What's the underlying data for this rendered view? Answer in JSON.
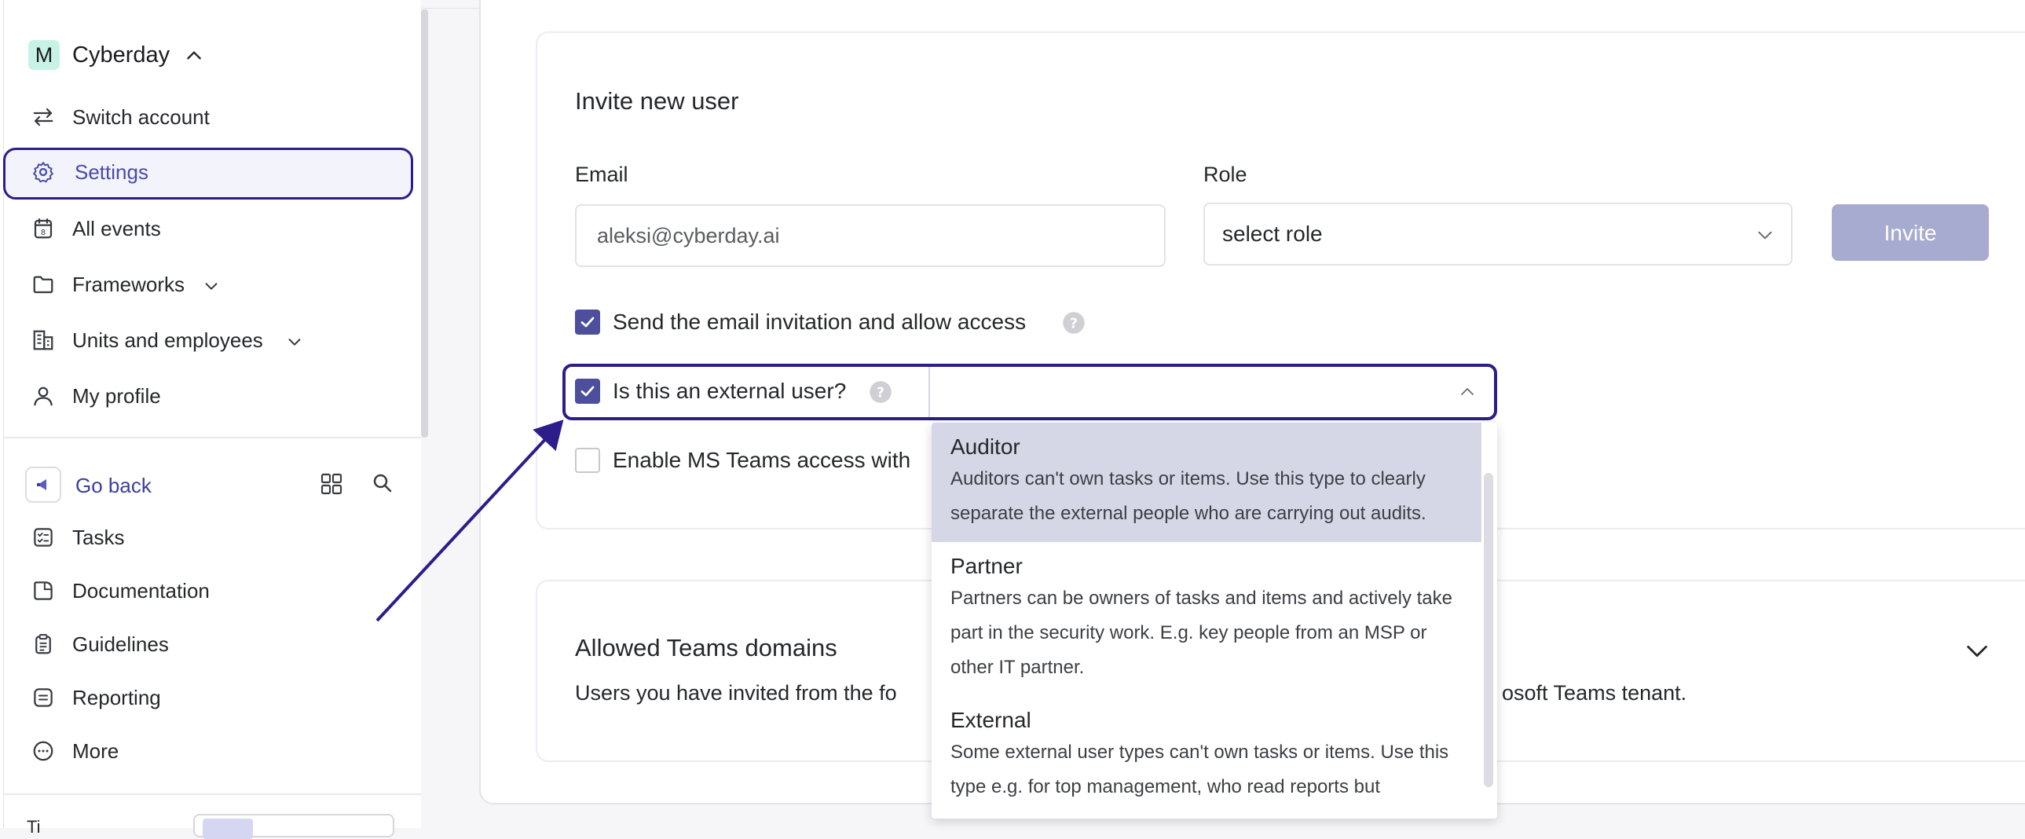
{
  "sidebar": {
    "account": {
      "badge": "M",
      "name": "Cyberday"
    },
    "nav": [
      {
        "label": "Switch account",
        "icon": "switch-arrows-icon"
      },
      {
        "label": "Settings",
        "icon": "gear-icon",
        "active": true
      },
      {
        "label": "All events",
        "icon": "calendar-icon"
      },
      {
        "label": "Frameworks",
        "icon": "folder-icon",
        "expandable": true
      },
      {
        "label": "Units and employees",
        "icon": "building-icon",
        "expandable": true
      },
      {
        "label": "My profile",
        "icon": "user-icon"
      }
    ],
    "go_back": "Go back",
    "sub_nav": [
      {
        "label": "Tasks",
        "icon": "checklist-icon"
      },
      {
        "label": "Documentation",
        "icon": "document-icon"
      },
      {
        "label": "Guidelines",
        "icon": "clipboard-icon"
      },
      {
        "label": "Reporting",
        "icon": "report-icon"
      },
      {
        "label": "More",
        "icon": "more-icon"
      }
    ],
    "bottom_cut_text": "Ti"
  },
  "invite": {
    "title": "Invite new user",
    "email_label": "Email",
    "email_value": "aleksi@cyberday.ai",
    "role_label": "Role",
    "role_placeholder": "select role",
    "invite_button": "Invite",
    "send_email_label": "Send the email invitation and allow access",
    "send_email_checked": true,
    "external_label": "Is this an external user?",
    "external_checked": true,
    "ms_teams_label": "Enable MS Teams access with",
    "ms_teams_checked": false
  },
  "external_type_dropdown": {
    "options": [
      {
        "title": "Auditor",
        "description": "Auditors can't own tasks or items. Use this type to clearly separate the external people who are carrying out audits.",
        "highlighted": true
      },
      {
        "title": "Partner",
        "description": "Partners can be owners of tasks and items and actively take part in the security work. E.g. key people from an MSP or other IT partner."
      },
      {
        "title": "External",
        "description": "Some external user types can't own tasks or items. Use this type e.g. for top management, who read reports but"
      }
    ]
  },
  "teams_domains": {
    "title": "Allowed Teams domains",
    "desc_left": "Users you have invited from the fo",
    "desc_right": "osoft Teams tenant."
  },
  "colors": {
    "accent": "#4d4f9c",
    "highlight_outline": "#2d1d8a",
    "invite_button_disabled": "#a7abcf",
    "selected_option": "#d6d7e6",
    "account_badge": "#c8f2e6"
  }
}
